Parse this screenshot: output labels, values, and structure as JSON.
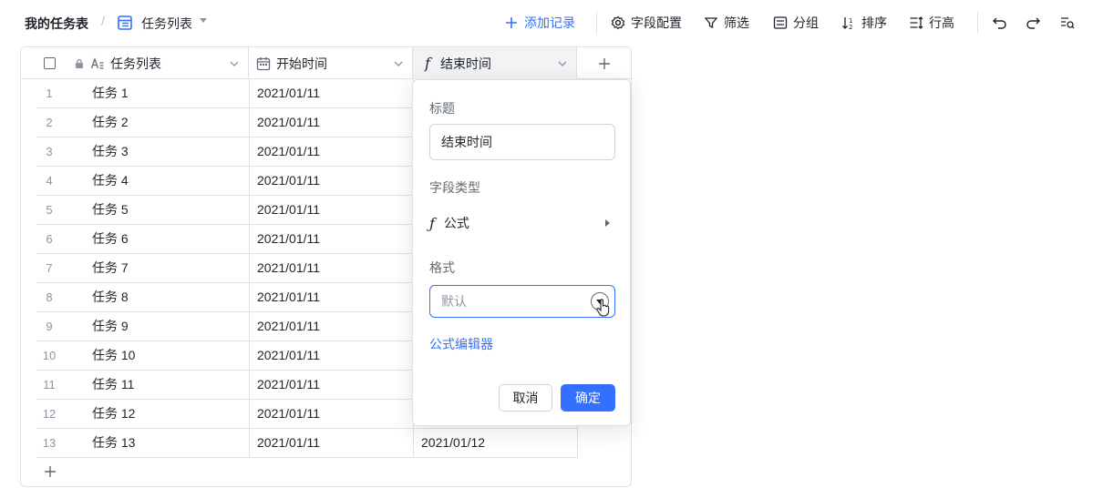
{
  "breadcrumb": {
    "root": "我的任务表",
    "separator": "/",
    "view": "任务列表"
  },
  "toolbar": {
    "add_record": "添加记录",
    "field_config": "字段配置",
    "filter": "筛选",
    "group": "分组",
    "sort": "排序",
    "row_height": "行高"
  },
  "table": {
    "columns": [
      {
        "label": "任务列表",
        "icon": "text-field-icon"
      },
      {
        "label": "开始时间",
        "icon": "calendar-icon"
      },
      {
        "label": "结束时间",
        "icon": "formula-icon",
        "icon_glyph": "f"
      }
    ],
    "rows": [
      {
        "num": "1",
        "name": "任务 1",
        "start": "2021/01/11",
        "end": ""
      },
      {
        "num": "2",
        "name": "任务 2",
        "start": "2021/01/11",
        "end": ""
      },
      {
        "num": "3",
        "name": "任务 3",
        "start": "2021/01/11",
        "end": ""
      },
      {
        "num": "4",
        "name": "任务 4",
        "start": "2021/01/11",
        "end": ""
      },
      {
        "num": "5",
        "name": "任务 5",
        "start": "2021/01/11",
        "end": ""
      },
      {
        "num": "6",
        "name": "任务 6",
        "start": "2021/01/11",
        "end": ""
      },
      {
        "num": "7",
        "name": "任务 7",
        "start": "2021/01/11",
        "end": ""
      },
      {
        "num": "8",
        "name": "任务 8",
        "start": "2021/01/11",
        "end": ""
      },
      {
        "num": "9",
        "name": "任务 9",
        "start": "2021/01/11",
        "end": ""
      },
      {
        "num": "10",
        "name": "任务 10",
        "start": "2021/01/11",
        "end": ""
      },
      {
        "num": "11",
        "name": "任务 11",
        "start": "2021/01/11",
        "end": ""
      },
      {
        "num": "12",
        "name": "任务 12",
        "start": "2021/01/11",
        "end": ""
      },
      {
        "num": "13",
        "name": "任务 13",
        "start": "2021/01/11",
        "end": "2021/01/12"
      }
    ]
  },
  "popover": {
    "title_label": "标题",
    "title_value": "结束时间",
    "type_label": "字段类型",
    "type_value": "公式",
    "format_label": "格式",
    "format_placeholder": "默认",
    "formula_editor": "公式编辑器",
    "cancel": "取消",
    "confirm": "确定"
  },
  "colors": {
    "accent": "#3370ff",
    "border": "#dee0e3",
    "muted": "#8f959e"
  }
}
